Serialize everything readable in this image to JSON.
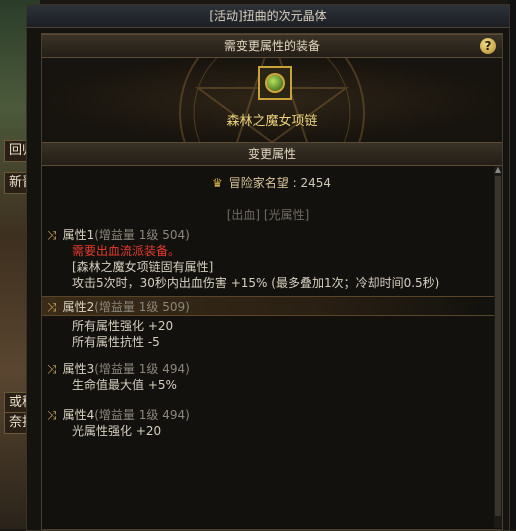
{
  "window": {
    "title": "[活动]扭曲的次元晶体"
  },
  "header": {
    "title": "需变更属性的装备",
    "help_icon": "question-icon"
  },
  "item": {
    "name": "森林之魔女项链"
  },
  "change_section": {
    "title": "变更属性"
  },
  "renown": {
    "label": "冒险家名望",
    "value": ": 2454"
  },
  "tags": "[出血] [光属性]",
  "background": {
    "chips": [
      "回归",
      "新晋",
      "或移",
      "奈拔"
    ]
  },
  "attributes": [
    {
      "title": "属性1",
      "level": "(增益量 1级 504)",
      "lines": [
        {
          "text": "需要出血流派装备。",
          "style": "red"
        },
        {
          "text": "[森林之魔女项链固有属性]",
          "style": "normal"
        },
        {
          "text": "攻击5次时，30秒内出血伤害 +15% (最多叠加1次；冷却时间0.5秒)",
          "style": "normal"
        }
      ]
    },
    {
      "title": "属性2",
      "level": "(增益量 1级 509)",
      "active": true,
      "lines": [
        {
          "text": "所有属性强化 +20",
          "style": "normal"
        },
        {
          "text": "所有属性抗性 -5",
          "style": "normal"
        }
      ]
    },
    {
      "title": "属性3",
      "level": "(增益量 1级 494)",
      "lines": [
        {
          "text": "生命值最大值 +5%",
          "style": "normal"
        }
      ]
    },
    {
      "title": "属性4",
      "level": "(增益量 1级 494)",
      "lines": [
        {
          "text": "光属性强化 +20",
          "style": "normal"
        }
      ]
    }
  ],
  "colors": {
    "accent_gold": "#d4b04a",
    "item_name": "#ecd27a",
    "warning_red": "#e63b2e"
  }
}
